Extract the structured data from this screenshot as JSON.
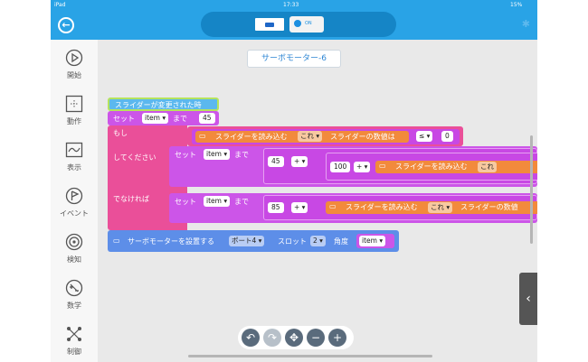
{
  "status": {
    "device": "iPad",
    "time": "17:33",
    "battery": "15%"
  },
  "topbar": {
    "device2_label": "ON"
  },
  "sidebar": [
    {
      "label": "開始",
      "icon": "play-icon"
    },
    {
      "label": "動作",
      "icon": "move-icon"
    },
    {
      "label": "表示",
      "icon": "display-icon"
    },
    {
      "label": "イベント",
      "icon": "flag-icon"
    },
    {
      "label": "検知",
      "icon": "sensor-icon"
    },
    {
      "label": "数学",
      "icon": "math-icon"
    },
    {
      "label": "制御",
      "icon": "control-icon"
    }
  ],
  "canvas": {
    "title": "サーボモーター-6"
  },
  "blocks": {
    "hat": "スライダーが変更された時",
    "set_label": "セット",
    "made": "まで",
    "var": "item",
    "val_45": "45",
    "val_85": "85",
    "val_100": "100",
    "val_0": "0",
    "if": "もし",
    "then": "してください",
    "else": "でなければ",
    "slider_read": "スライダーを読み込む",
    "this": "これ",
    "slider_value": "スライダーの数値は",
    "slider_value_trunc": "スライダーの数値",
    "op_le": "≤",
    "op_plus": "+",
    "servo_set": "サーボモーターを設置する",
    "port": "ポート4",
    "slot": "スロット",
    "slot_val": "2",
    "angle": "角度"
  }
}
